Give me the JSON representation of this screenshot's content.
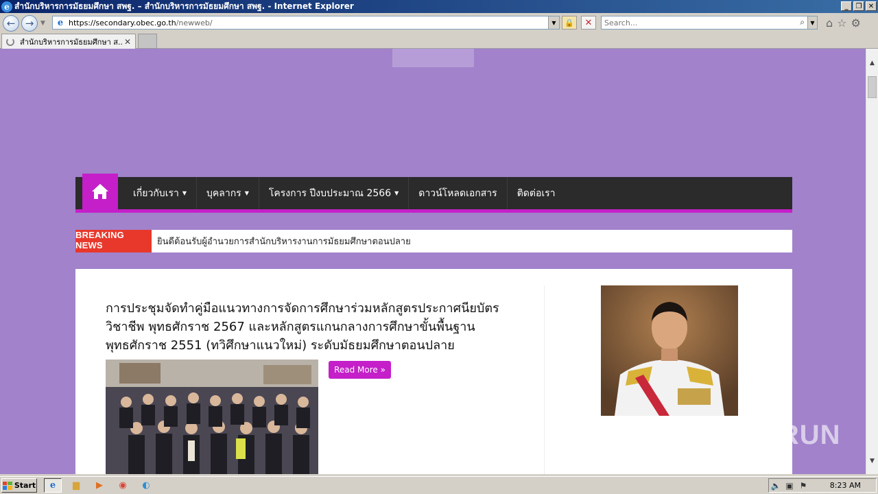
{
  "window": {
    "title": "สำนักบริหารการมัธยมศึกษา สพฐ. – สำนักบริหารการมัธยมศึกษา สพฐ. - Internet Explorer"
  },
  "addressbar": {
    "url_main": "https://secondary.obec.go.th",
    "url_path": "/newweb/",
    "search_placeholder": "Search..."
  },
  "tab": {
    "label": "สำนักบริหารการมัธยมศึกษา ส..."
  },
  "page": {
    "nav": {
      "home_icon": "home-icon",
      "items": [
        {
          "label": "เกี่ยวกับเรา",
          "has_dropdown": true
        },
        {
          "label": "บุคลากร",
          "has_dropdown": true
        },
        {
          "label": "โครงการ ปีงบประมาณ 2566",
          "has_dropdown": true
        },
        {
          "label": "ดาวน์โหลดเอกสาร",
          "has_dropdown": false
        },
        {
          "label": "ติดต่อเรา",
          "has_dropdown": false
        }
      ]
    },
    "breaking": {
      "label": "Breaking News",
      "text": "ยินดีต้อนรับผู้อำนวยการสำนักบริหารงานการมัธยมศึกษาตอนปลาย"
    },
    "post": {
      "title": "การประชุมจัดทำคู่มือแนวทางการจัดการศึกษาร่วมหลักสูตรประกาศนียบัตรวิชาชีพ พุทธศักราช 2567 และหลักสูตรแกนกลางการศึกษาขั้นพื้นฐาน พุทธศักราช 2551 (ทวิศึกษาแนวใหม่) ระดับมัธยมศึกษาตอนปลาย",
      "read_more": "Read More »"
    }
  },
  "watermark": "ANY RUN",
  "taskbar": {
    "start_label": "Start",
    "time": "8:23 AM"
  },
  "colors": {
    "page_bg": "#a182cb",
    "accent": "#c41fc9",
    "nav_bg": "#2b2b2b",
    "breaking_red": "#e8382c"
  }
}
